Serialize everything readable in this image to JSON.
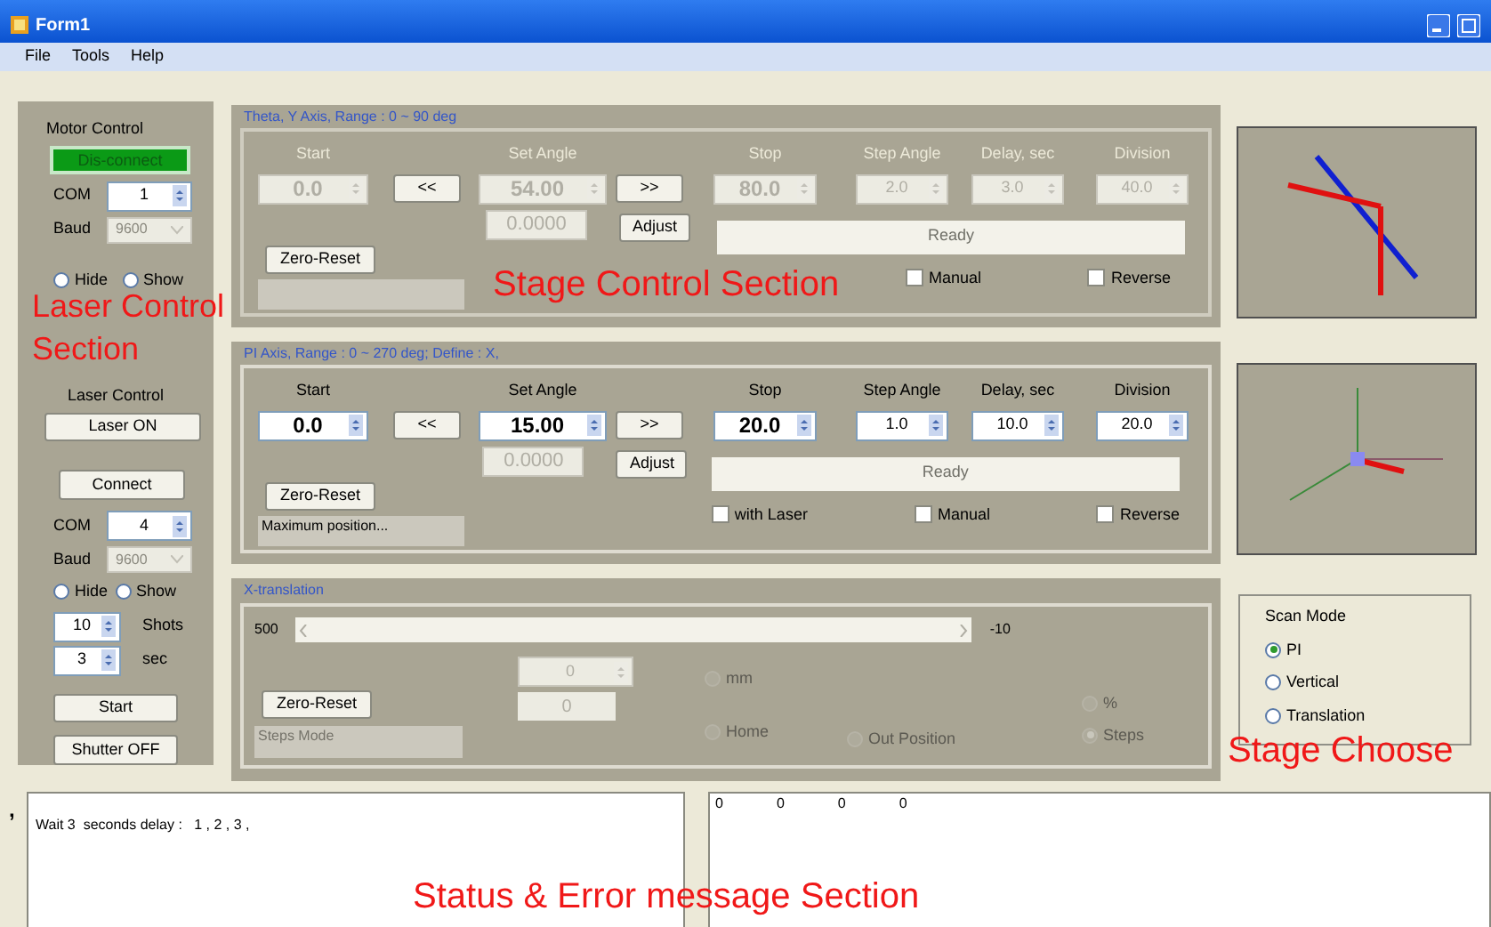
{
  "window": {
    "title": "Form1"
  },
  "menu": [
    "File",
    "Tools",
    "Help"
  ],
  "motor_control": {
    "title": "Motor Control",
    "connect_button": "Dis-connect",
    "connected": true,
    "com_label": "COM",
    "com": "1",
    "baud_label": "Baud",
    "baud": "9600",
    "radios": [
      {
        "label": "Hide",
        "selected": false
      },
      {
        "label": "Show",
        "selected": false
      }
    ]
  },
  "laser_control": {
    "title": "Laser Control",
    "laser_button": "Laser ON",
    "connect_button": "Connect",
    "com_label": "COM",
    "com": "4",
    "baud_label": "Baud",
    "baud": "9600",
    "radios": [
      {
        "label": "Hide",
        "selected": false
      },
      {
        "label": "Show",
        "selected": false
      }
    ],
    "shots": "10",
    "shots_label": "Shots",
    "sec": "3",
    "sec_label": "sec",
    "start_button": "Start",
    "shutter_button": "Shutter OFF"
  },
  "axes": [
    {
      "legend": "Theta, Y  Axis,  Range : 0 ~ 90 deg",
      "disabled": true,
      "headers": [
        "Start",
        "Set Angle",
        "Stop",
        "Step Angle",
        "Delay, sec",
        "Division"
      ],
      "start": "0.0",
      "set_angle": "54.00",
      "stop": "80.0",
      "step_angle": "2.0",
      "delay": "3.0",
      "division": "40.0",
      "back_button": "<<",
      "forward_button": ">>",
      "readout": "0.0000",
      "adjust_button": "Adjust",
      "zero_button": "Zero-Reset",
      "status": "Ready",
      "checkboxes": [
        {
          "label": "Manual",
          "checked": false
        },
        {
          "label": "Reverse",
          "checked": false
        }
      ]
    },
    {
      "legend": "PI Axis,  Range :  0 ~ 270 deg; Define : X,",
      "disabled": false,
      "headers": [
        "Start",
        "Set Angle",
        "Stop",
        "Step Angle",
        "Delay, sec",
        "Division"
      ],
      "start": "0.0",
      "set_angle": "15.00",
      "stop": "20.0",
      "step_angle": "1.0",
      "delay": "10.0",
      "division": "20.0",
      "back_button": "<<",
      "forward_button": ">>",
      "readout": "0.0000",
      "adjust_button": "Adjust",
      "zero_button": "Zero-Reset",
      "status": "Ready",
      "info": "Maximum position...",
      "checkboxes": [
        {
          "label": "with Laser",
          "checked": false
        },
        {
          "label": "Manual",
          "checked": false
        },
        {
          "label": "Reverse",
          "checked": false
        }
      ]
    }
  ],
  "x_translation": {
    "legend": "X-translation",
    "min_label": "500",
    "max_label": "-10",
    "spin": "0",
    "readout": "0",
    "zero_button": "Zero-Reset",
    "mode": "Steps Mode",
    "radios": [
      {
        "label": "mm",
        "selected": false
      },
      {
        "label": "Home",
        "selected": false
      },
      {
        "label": "Out Position",
        "selected": false
      },
      {
        "label": "%",
        "selected": false
      },
      {
        "label": "Steps",
        "selected": true
      }
    ]
  },
  "scan_mode": {
    "title": "Scan Mode",
    "options": [
      {
        "label": "PI",
        "selected": true
      },
      {
        "label": "Vertical",
        "selected": false
      },
      {
        "label": "Translation",
        "selected": false
      }
    ]
  },
  "stray_mark": ",",
  "status_log": "Wait 3  seconds delay :   1 , 2 , 3 ,",
  "readings": [
    "0",
    "0",
    "0",
    "0"
  ],
  "annotations": [
    {
      "text": "Laser Control Section"
    },
    {
      "text": "Stage Control Section"
    },
    {
      "text": "Stage Choose"
    },
    {
      "text": "Status & Error message Section"
    }
  ]
}
